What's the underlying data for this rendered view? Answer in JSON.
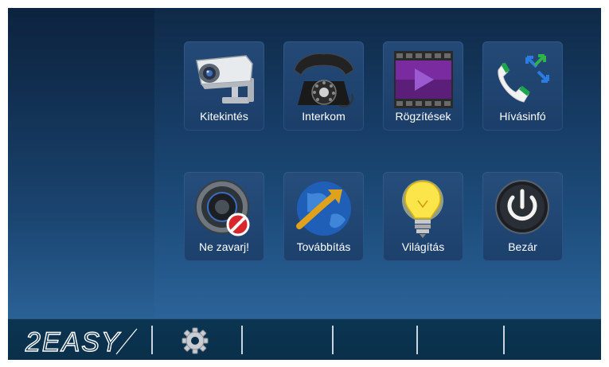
{
  "brand": {
    "logo_text": "2EASY"
  },
  "tiles": [
    {
      "label": "Kitekintés",
      "icon": "security-camera-icon"
    },
    {
      "label": "Interkom",
      "icon": "rotary-phone-icon"
    },
    {
      "label": "Rögzítések",
      "icon": "video-play-icon"
    },
    {
      "label": "Hívásinfó",
      "icon": "call-info-icon"
    },
    {
      "label": "Ne zavarj!",
      "icon": "do-not-disturb-speaker-icon"
    },
    {
      "label": "Továbbítás",
      "icon": "globe-forward-icon"
    },
    {
      "label": "Világítás",
      "icon": "light-bulb-icon"
    },
    {
      "label": "Bezár",
      "icon": "power-icon"
    }
  ],
  "bottom_bar": {
    "settings_icon": "gear-icon"
  },
  "colors": {
    "background_top": "#0f2a48",
    "background_bottom": "#2f6aa0",
    "bar": "#0a2f4a",
    "label": "#ffffff"
  }
}
